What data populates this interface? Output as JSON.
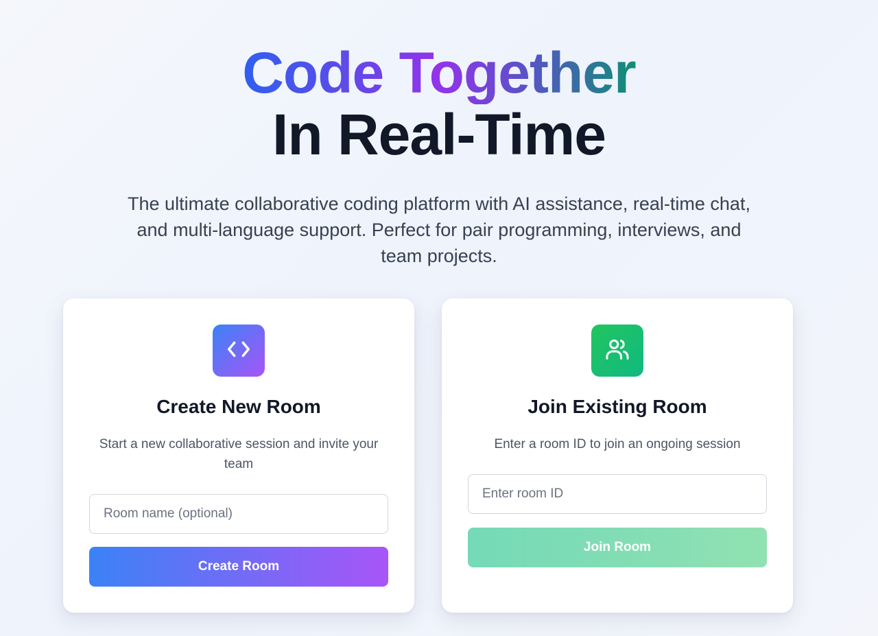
{
  "hero": {
    "headline_line1": "Code Together",
    "headline_line2": "In Real-Time",
    "subtitle": "The ultimate collaborative coding platform with AI assistance, real-time chat, and multi-language support. Perfect for pair programming, interviews, and team projects."
  },
  "create_card": {
    "icon": "code-brackets-icon",
    "title": "Create New Room",
    "description": "Start a new collaborative session and invite your team",
    "input_placeholder": "Room name (optional)",
    "input_value": "",
    "button_label": "Create Room"
  },
  "join_card": {
    "icon": "users-icon",
    "title": "Join Existing Room",
    "description": "Enter a room ID to join an ongoing session",
    "input_placeholder": "Enter room ID",
    "input_value": "",
    "button_label": "Join Room",
    "button_state": "disabled"
  },
  "colors": {
    "create_gradient_start": "#3b82f6",
    "create_gradient_end": "#a855f7",
    "join_icon": "#22c55e",
    "join_button_disabled": "#7ddcb3",
    "headline_dark": "#111827"
  }
}
